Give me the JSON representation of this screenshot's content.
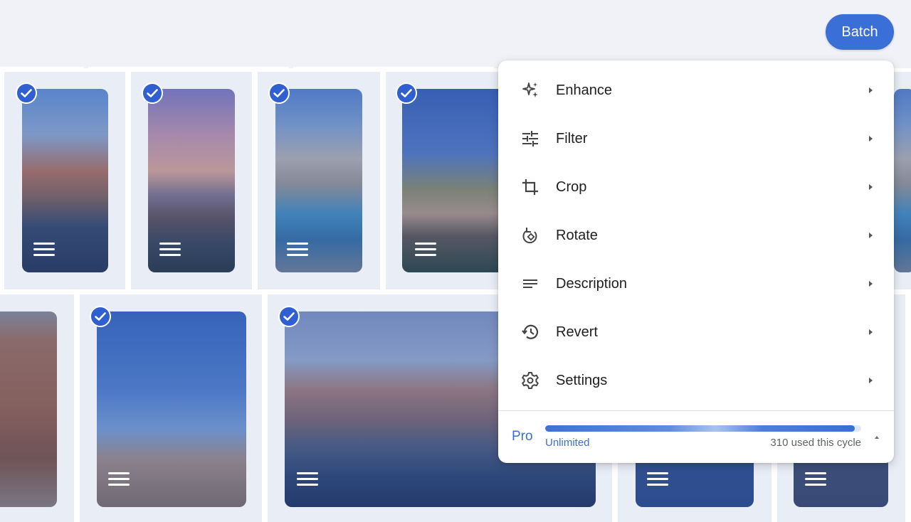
{
  "toolbar": {
    "batch_label": "Batch"
  },
  "menu": {
    "items": [
      {
        "label": "Enhance",
        "icon": "sparkle-icon"
      },
      {
        "label": "Filter",
        "icon": "tune-icon"
      },
      {
        "label": "Crop",
        "icon": "crop-icon"
      },
      {
        "label": "Rotate",
        "icon": "rotate-icon"
      },
      {
        "label": "Description",
        "icon": "notes-icon"
      },
      {
        "label": "Revert",
        "icon": "history-icon"
      },
      {
        "label": "Settings",
        "icon": "gear-icon"
      }
    ],
    "plan": {
      "name": "Pro",
      "quota": "Unlimited",
      "usage_text": "310 used this cycle",
      "usage_fraction": 0.98
    }
  },
  "colors": {
    "accent": "#3a6fd8",
    "selection_check": "#2f5fd0",
    "background": "#eef1f7"
  }
}
